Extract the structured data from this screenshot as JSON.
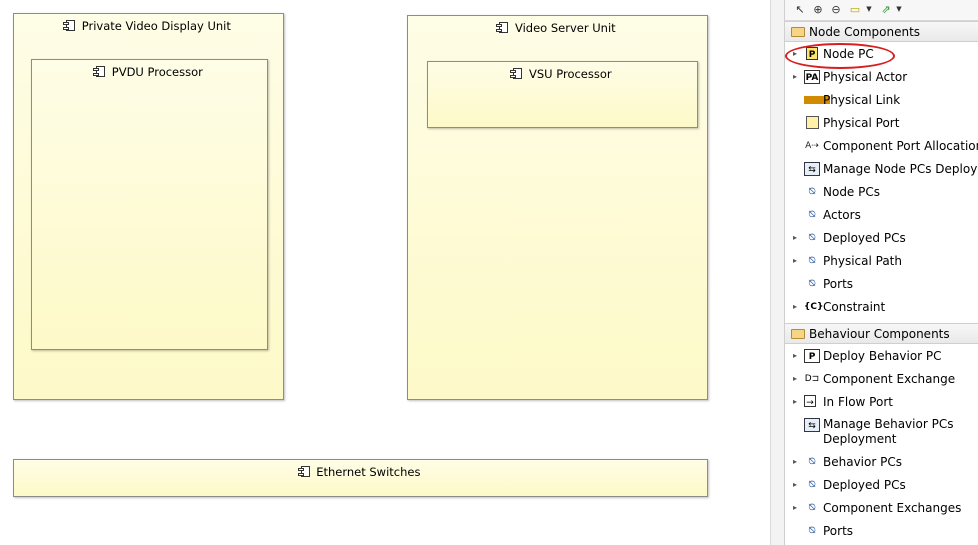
{
  "diagram": {
    "nodes": {
      "pvdu": "Private Video Display Unit",
      "pvdu_processor": "PVDU Processor",
      "vsu": "Video Server Unit",
      "vsu_processor": "VSU Processor",
      "ethernet": "Ethernet Switches"
    }
  },
  "palette": {
    "toolbar": {
      "select": "↖",
      "zoom_in": "⊕",
      "zoom_out": "⊖",
      "note": "▭",
      "pin": "⇗"
    },
    "node_drawer": "Node Components",
    "node_items": [
      {
        "label": "Node PC",
        "icon": "node-pc-icon",
        "glyph": "P"
      },
      {
        "label": "Physical Actor",
        "icon": "physical-actor-icon",
        "glyph": "PA"
      },
      {
        "label": "Physical Link",
        "icon": "physical-link-icon",
        "glyph": ""
      },
      {
        "label": "Physical Port",
        "icon": "physical-port-icon",
        "glyph": ""
      },
      {
        "label": "Component Port Allocation",
        "icon": "port-allocation-icon",
        "glyph": "A⇢"
      },
      {
        "label": "Manage Node PCs Deployment",
        "icon": "manage-icon",
        "glyph": "⇆"
      },
      {
        "label": "Node PCs",
        "icon": "filter-icon",
        "glyph": "⦰"
      },
      {
        "label": "Actors",
        "icon": "filter-icon",
        "glyph": "⦰"
      },
      {
        "label": "Deployed PCs",
        "icon": "filter-icon",
        "glyph": "⦰"
      },
      {
        "label": "Physical Path",
        "icon": "filter-icon",
        "glyph": "⦰"
      },
      {
        "label": "Ports",
        "icon": "filter-icon",
        "glyph": "⦰"
      },
      {
        "label": "Constraint",
        "icon": "constraint-icon",
        "glyph": "{C}"
      }
    ],
    "behaviour_drawer": "Behaviour Components",
    "behaviour_items": [
      {
        "label": "Deploy Behavior PC",
        "icon": "deploy-behavior-icon",
        "glyph": "P"
      },
      {
        "label": "Component Exchange",
        "icon": "component-exchange-icon",
        "glyph": "D⊐"
      },
      {
        "label": "In Flow Port",
        "icon": "in-flow-port-icon",
        "glyph": "→"
      },
      {
        "label": "Manage Behavior PCs Deployment",
        "icon": "manage-icon",
        "glyph": "⇆"
      },
      {
        "label": "Behavior PCs",
        "icon": "filter-icon",
        "glyph": "⦰"
      },
      {
        "label": "Deployed PCs",
        "icon": "filter-icon",
        "glyph": "⦰"
      },
      {
        "label": "Component Exchanges",
        "icon": "filter-icon",
        "glyph": "⦰"
      },
      {
        "label": "Ports",
        "icon": "filter-icon",
        "glyph": "⦰"
      }
    ],
    "colors": {
      "node_fill": "#fdf9c8",
      "highlight": "#d61f1f",
      "filter_icon": "#2c5aa0"
    }
  }
}
